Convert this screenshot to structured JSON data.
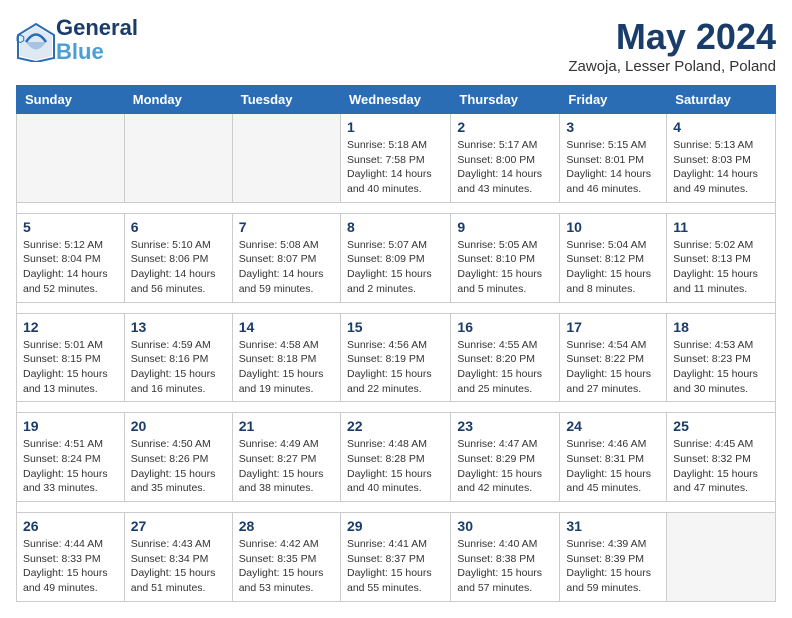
{
  "header": {
    "logo_line1": "General",
    "logo_line2": "Blue",
    "month_year": "May 2024",
    "location": "Zawoja, Lesser Poland, Poland"
  },
  "weekdays": [
    "Sunday",
    "Monday",
    "Tuesday",
    "Wednesday",
    "Thursday",
    "Friday",
    "Saturday"
  ],
  "weeks": [
    [
      {
        "day": "",
        "info": ""
      },
      {
        "day": "",
        "info": ""
      },
      {
        "day": "",
        "info": ""
      },
      {
        "day": "1",
        "info": "Sunrise: 5:18 AM\nSunset: 7:58 PM\nDaylight: 14 hours\nand 40 minutes."
      },
      {
        "day": "2",
        "info": "Sunrise: 5:17 AM\nSunset: 8:00 PM\nDaylight: 14 hours\nand 43 minutes."
      },
      {
        "day": "3",
        "info": "Sunrise: 5:15 AM\nSunset: 8:01 PM\nDaylight: 14 hours\nand 46 minutes."
      },
      {
        "day": "4",
        "info": "Sunrise: 5:13 AM\nSunset: 8:03 PM\nDaylight: 14 hours\nand 49 minutes."
      }
    ],
    [
      {
        "day": "5",
        "info": "Sunrise: 5:12 AM\nSunset: 8:04 PM\nDaylight: 14 hours\nand 52 minutes."
      },
      {
        "day": "6",
        "info": "Sunrise: 5:10 AM\nSunset: 8:06 PM\nDaylight: 14 hours\nand 56 minutes."
      },
      {
        "day": "7",
        "info": "Sunrise: 5:08 AM\nSunset: 8:07 PM\nDaylight: 14 hours\nand 59 minutes."
      },
      {
        "day": "8",
        "info": "Sunrise: 5:07 AM\nSunset: 8:09 PM\nDaylight: 15 hours\nand 2 minutes."
      },
      {
        "day": "9",
        "info": "Sunrise: 5:05 AM\nSunset: 8:10 PM\nDaylight: 15 hours\nand 5 minutes."
      },
      {
        "day": "10",
        "info": "Sunrise: 5:04 AM\nSunset: 8:12 PM\nDaylight: 15 hours\nand 8 minutes."
      },
      {
        "day": "11",
        "info": "Sunrise: 5:02 AM\nSunset: 8:13 PM\nDaylight: 15 hours\nand 11 minutes."
      }
    ],
    [
      {
        "day": "12",
        "info": "Sunrise: 5:01 AM\nSunset: 8:15 PM\nDaylight: 15 hours\nand 13 minutes."
      },
      {
        "day": "13",
        "info": "Sunrise: 4:59 AM\nSunset: 8:16 PM\nDaylight: 15 hours\nand 16 minutes."
      },
      {
        "day": "14",
        "info": "Sunrise: 4:58 AM\nSunset: 8:18 PM\nDaylight: 15 hours\nand 19 minutes."
      },
      {
        "day": "15",
        "info": "Sunrise: 4:56 AM\nSunset: 8:19 PM\nDaylight: 15 hours\nand 22 minutes."
      },
      {
        "day": "16",
        "info": "Sunrise: 4:55 AM\nSunset: 8:20 PM\nDaylight: 15 hours\nand 25 minutes."
      },
      {
        "day": "17",
        "info": "Sunrise: 4:54 AM\nSunset: 8:22 PM\nDaylight: 15 hours\nand 27 minutes."
      },
      {
        "day": "18",
        "info": "Sunrise: 4:53 AM\nSunset: 8:23 PM\nDaylight: 15 hours\nand 30 minutes."
      }
    ],
    [
      {
        "day": "19",
        "info": "Sunrise: 4:51 AM\nSunset: 8:24 PM\nDaylight: 15 hours\nand 33 minutes."
      },
      {
        "day": "20",
        "info": "Sunrise: 4:50 AM\nSunset: 8:26 PM\nDaylight: 15 hours\nand 35 minutes."
      },
      {
        "day": "21",
        "info": "Sunrise: 4:49 AM\nSunset: 8:27 PM\nDaylight: 15 hours\nand 38 minutes."
      },
      {
        "day": "22",
        "info": "Sunrise: 4:48 AM\nSunset: 8:28 PM\nDaylight: 15 hours\nand 40 minutes."
      },
      {
        "day": "23",
        "info": "Sunrise: 4:47 AM\nSunset: 8:29 PM\nDaylight: 15 hours\nand 42 minutes."
      },
      {
        "day": "24",
        "info": "Sunrise: 4:46 AM\nSunset: 8:31 PM\nDaylight: 15 hours\nand 45 minutes."
      },
      {
        "day": "25",
        "info": "Sunrise: 4:45 AM\nSunset: 8:32 PM\nDaylight: 15 hours\nand 47 minutes."
      }
    ],
    [
      {
        "day": "26",
        "info": "Sunrise: 4:44 AM\nSunset: 8:33 PM\nDaylight: 15 hours\nand 49 minutes."
      },
      {
        "day": "27",
        "info": "Sunrise: 4:43 AM\nSunset: 8:34 PM\nDaylight: 15 hours\nand 51 minutes."
      },
      {
        "day": "28",
        "info": "Sunrise: 4:42 AM\nSunset: 8:35 PM\nDaylight: 15 hours\nand 53 minutes."
      },
      {
        "day": "29",
        "info": "Sunrise: 4:41 AM\nSunset: 8:37 PM\nDaylight: 15 hours\nand 55 minutes."
      },
      {
        "day": "30",
        "info": "Sunrise: 4:40 AM\nSunset: 8:38 PM\nDaylight: 15 hours\nand 57 minutes."
      },
      {
        "day": "31",
        "info": "Sunrise: 4:39 AM\nSunset: 8:39 PM\nDaylight: 15 hours\nand 59 minutes."
      },
      {
        "day": "",
        "info": ""
      }
    ]
  ]
}
